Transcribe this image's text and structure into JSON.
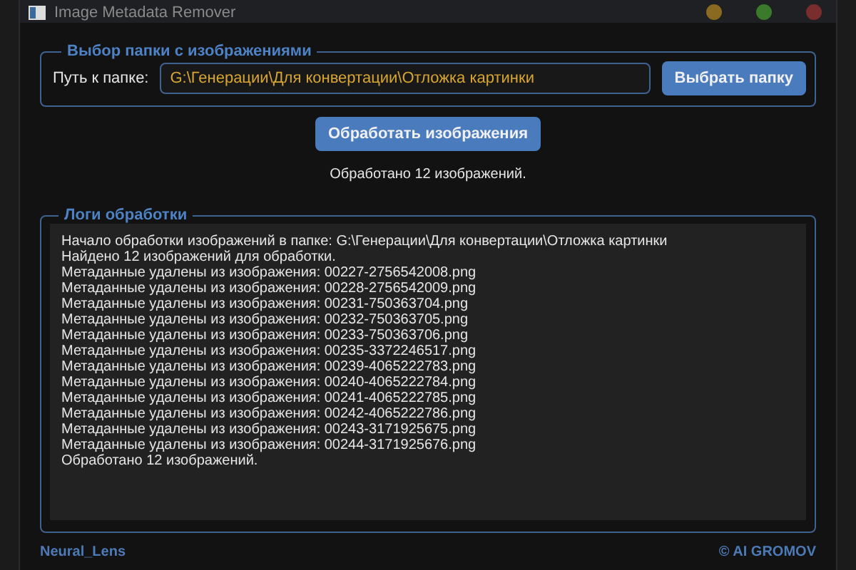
{
  "window": {
    "title": "Image Metadata Remover"
  },
  "folder_group": {
    "title": "Выбор папки с изображениями",
    "label": "Путь к папке:",
    "value": "G:\\Генерации\\Для конвертации\\Отложка картинки",
    "button": "Выбрать папку"
  },
  "process_button": "Обработать изображения",
  "status": "Обработано 12 изображений.",
  "logs_group": {
    "title": "Логи обработки",
    "lines": [
      "Начало обработки изображений в папке: G:\\Генерации\\Для конвертации\\Отложка картинки",
      "Найдено 12 изображений для обработки.",
      "Метаданные удалены из изображения: 00227-2756542008.png",
      "Метаданные удалены из изображения: 00228-2756542009.png",
      "Метаданные удалены из изображения: 00231-750363704.png",
      "Метаданные удалены из изображения: 00232-750363705.png",
      "Метаданные удалены из изображения: 00233-750363706.png",
      "Метаданные удалены из изображения: 00235-3372246517.png",
      "Метаданные удалены из изображения: 00239-4065222783.png",
      "Метаданные удалены из изображения: 00240-4065222784.png",
      "Метаданные удалены из изображения: 00241-4065222785.png",
      "Метаданные удалены из изображения: 00242-4065222786.png",
      "Метаданные удалены из изображения: 00243-3171925675.png",
      "Метаданные удалены из изображения: 00244-3171925676.png",
      "Обработано 12 изображений."
    ]
  },
  "footer": {
    "left": "Neural_Lens",
    "right": "© AI GROMOV"
  }
}
